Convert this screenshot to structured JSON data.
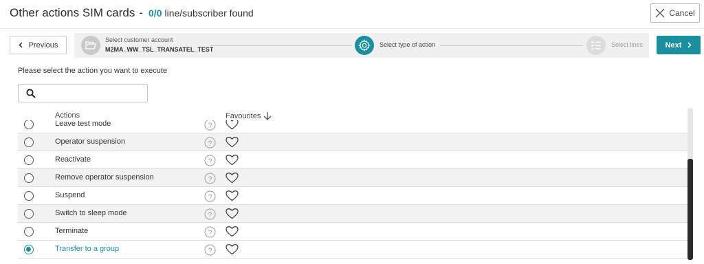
{
  "header": {
    "title": "Other actions SIM cards",
    "separator": "-",
    "count": "0/0",
    "found_text": "line/subscriber found",
    "cancel_label": "Cancel"
  },
  "nav": {
    "previous_label": "Previous",
    "next_label": "Next"
  },
  "stepper": {
    "step1_label": "Select customer account",
    "step1_value": "M2MA_WW_TSL_TRANSATEL_TEST",
    "step2_label": "Select type of action",
    "step3_label": "Select lines",
    "step1_icon": "folder-icon",
    "step2_icon": "gear-icon",
    "step3_icon": "checklist-icon"
  },
  "instruction": "Please select the action you want to execute",
  "search": {
    "placeholder": "",
    "value": ""
  },
  "table": {
    "col_actions": "Actions",
    "col_favourites": "Favourites",
    "rows": [
      {
        "label": "Leave test mode",
        "selected": false
      },
      {
        "label": "Operator suspension",
        "selected": false
      },
      {
        "label": "Reactivate",
        "selected": false
      },
      {
        "label": "Remove operator suspension",
        "selected": false
      },
      {
        "label": "Suspend",
        "selected": false
      },
      {
        "label": "Switch to sleep mode",
        "selected": false
      },
      {
        "label": "Terminate",
        "selected": false
      },
      {
        "label": "Transfer to a group",
        "selected": true
      }
    ]
  },
  "colors": {
    "accent": "#1a8fa0",
    "row_alt": "#f2f2f2"
  }
}
